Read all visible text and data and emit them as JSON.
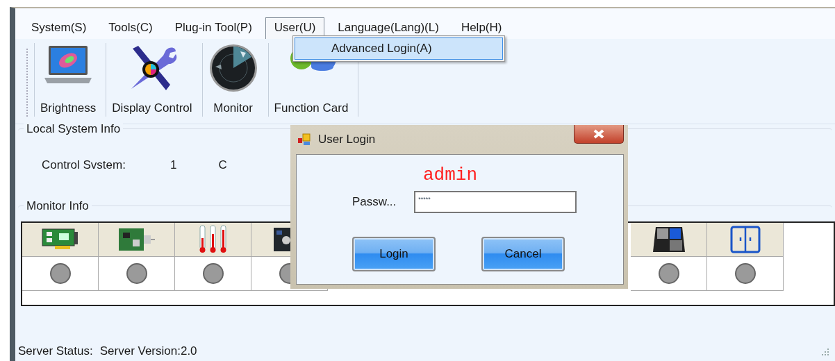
{
  "menu": [
    {
      "label": "System(S)",
      "open": false
    },
    {
      "label": "Tools(C)",
      "open": false
    },
    {
      "label": "Plug-in Tool(P)",
      "open": false
    },
    {
      "label": "User(U)",
      "open": true
    },
    {
      "label": "Language(Lang)(L)",
      "open": false
    },
    {
      "label": "Help(H)",
      "open": false
    }
  ],
  "dropdown": {
    "items": [
      {
        "label": "Advanced Login(A)",
        "selected": true
      }
    ]
  },
  "toolbar": [
    {
      "label": "Brightness",
      "kind": "laptop"
    },
    {
      "label": "Display Control",
      "kind": "tools"
    },
    {
      "label": "Monitor",
      "kind": "radar"
    },
    {
      "label": "Function Card",
      "kind": "balls"
    }
  ],
  "local_system_info": {
    "title": "Local System Info",
    "fields": [
      {
        "label": "Control Svstem:",
        "value": "1"
      },
      {
        "label": "C"
      }
    ]
  },
  "monitor_info": {
    "title": "Monitor Info",
    "columns_left": [
      {
        "kind": "card"
      },
      {
        "kind": "board"
      },
      {
        "kind": "thermometers"
      },
      {
        "kind": "chip"
      }
    ],
    "columns_right": [
      {
        "kind": "screen"
      },
      {
        "kind": "cabinet"
      }
    ]
  },
  "status_bar": {
    "label": "Server Status:",
    "version": "Server Version:2.0"
  },
  "dialog": {
    "title": "User Login",
    "annotation": "admin",
    "password_label": "Passw...",
    "password_value": "*****",
    "buttons": [
      "Login",
      "Cancel"
    ]
  }
}
